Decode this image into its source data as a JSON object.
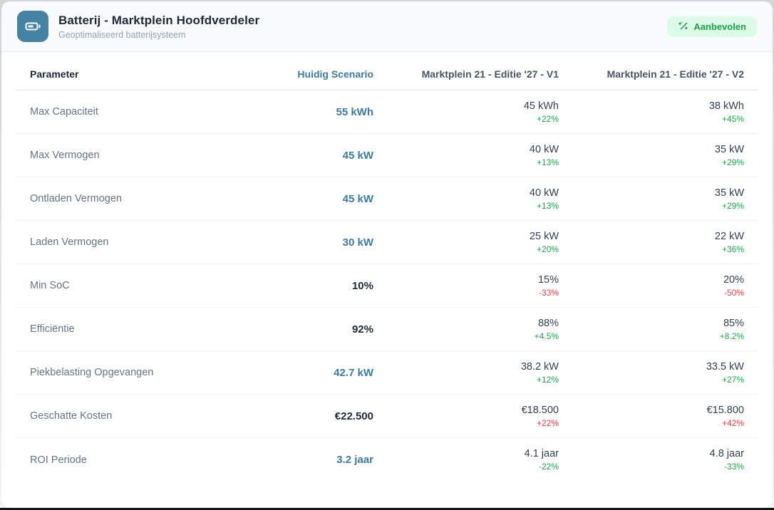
{
  "header": {
    "title": "Batterij - Marktplein Hoofdverdeler",
    "subtitle": "Geoptimaliseerd batterijsysteem",
    "badge_label": "Aanbevolen",
    "icons": {
      "app_icon": "battery-icon",
      "badge_icon": "wand-sparkles-icon"
    }
  },
  "colors": {
    "accent_blue": "#3a7ca6",
    "icon_background": "#4583a5",
    "positive_green": "#1ba94c",
    "negative_red": "#ef4444",
    "badge_background": "#dcfce7",
    "badge_text": "#16a34a",
    "header_background": "#f8fafc"
  },
  "table": {
    "columns": [
      "Parameter",
      "Huidig Scenario",
      "Marktplein 21 - Editie '27 - V1",
      "Marktplein 21 - Editie '27 - V2"
    ],
    "rows": [
      {
        "parameter": "Max Capaciteit",
        "current": {
          "value": "55 kWh",
          "style": "accent"
        },
        "v1": {
          "value": "45 kWh",
          "delta": "+22%",
          "delta_color": "green"
        },
        "v2": {
          "value": "38 kWh",
          "delta": "+45%",
          "delta_color": "green"
        }
      },
      {
        "parameter": "Max Vermogen",
        "current": {
          "value": "45 kW",
          "style": "accent"
        },
        "v1": {
          "value": "40 kW",
          "delta": "+13%",
          "delta_color": "green"
        },
        "v2": {
          "value": "35 kW",
          "delta": "+29%",
          "delta_color": "green"
        }
      },
      {
        "parameter": "Ontladen Vermogen",
        "current": {
          "value": "45 kW",
          "style": "accent"
        },
        "v1": {
          "value": "40 kW",
          "delta": "+13%",
          "delta_color": "green"
        },
        "v2": {
          "value": "35 kW",
          "delta": "+29%",
          "delta_color": "green"
        }
      },
      {
        "parameter": "Laden Vermogen",
        "current": {
          "value": "30 kW",
          "style": "accent"
        },
        "v1": {
          "value": "25 kW",
          "delta": "+20%",
          "delta_color": "green"
        },
        "v2": {
          "value": "22 kW",
          "delta": "+36%",
          "delta_color": "green"
        }
      },
      {
        "parameter": "Min SoC",
        "current": {
          "value": "10%",
          "style": "dark"
        },
        "v1": {
          "value": "15%",
          "delta": "-33%",
          "delta_color": "red"
        },
        "v2": {
          "value": "20%",
          "delta": "-50%",
          "delta_color": "red"
        }
      },
      {
        "parameter": "Efficiëntie",
        "current": {
          "value": "92%",
          "style": "dark"
        },
        "v1": {
          "value": "88%",
          "delta": "+4.5%",
          "delta_color": "green"
        },
        "v2": {
          "value": "85%",
          "delta": "+8.2%",
          "delta_color": "green"
        }
      },
      {
        "parameter": "Piekbelasting Opgevangen",
        "current": {
          "value": "42.7 kW",
          "style": "accent"
        },
        "v1": {
          "value": "38.2 kW",
          "delta": "+12%",
          "delta_color": "green"
        },
        "v2": {
          "value": "33.5 kW",
          "delta": "+27%",
          "delta_color": "green"
        }
      },
      {
        "parameter": "Geschatte Kosten",
        "current": {
          "value": "€22.500",
          "style": "dark"
        },
        "v1": {
          "value": "€18.500",
          "delta": "+22%",
          "delta_color": "red"
        },
        "v2": {
          "value": "€15.800",
          "delta": "+42%",
          "delta_color": "red"
        }
      },
      {
        "parameter": "ROI Periode",
        "current": {
          "value": "3.2 jaar",
          "style": "accent"
        },
        "v1": {
          "value": "4.1 jaar",
          "delta": "-22%",
          "delta_color": "green"
        },
        "v2": {
          "value": "4.8 jaar",
          "delta": "-33%",
          "delta_color": "green"
        }
      }
    ]
  }
}
